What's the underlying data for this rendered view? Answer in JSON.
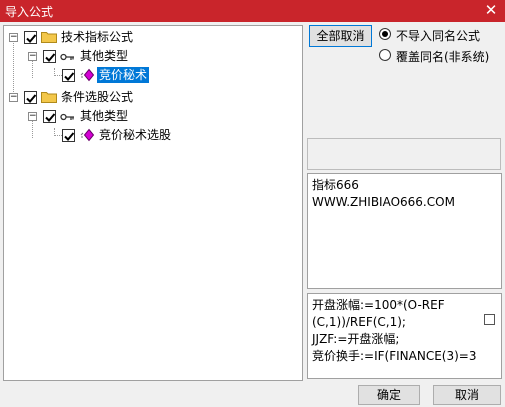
{
  "window": {
    "title": "导入公式",
    "close_glyph": "✕"
  },
  "tree": {
    "nodes": [
      {
        "label": "技术指标公式",
        "checked": true,
        "expanded": true,
        "icon": "folder-icon"
      },
      {
        "label": "其他类型",
        "checked": true,
        "expanded": true,
        "icon": "key-icon"
      },
      {
        "label": "竞价秘术",
        "checked": true,
        "selected": true,
        "icon": "formula-gem-icon"
      },
      {
        "label": "条件选股公式",
        "checked": true,
        "expanded": true,
        "icon": "folder-icon"
      },
      {
        "label": "其他类型",
        "checked": true,
        "expanded": true,
        "icon": "key-icon"
      },
      {
        "label": "竞价秘术选股",
        "checked": true,
        "icon": "formula-gem-icon"
      }
    ]
  },
  "options": {
    "deselect_all_label": "全部取消",
    "radio_no_import_label": "不导入同名公式",
    "radio_overwrite_label": "覆盖同名(非系统)",
    "selected_option": "不导入同名公式"
  },
  "info": {
    "line1": "指标666",
    "line2": "WWW.ZHIBIAO666.COM"
  },
  "formula": {
    "line1": "开盘涨幅:=100*(O-REF",
    "line2": "(C,1))/REF(C,1);",
    "line3": "JJZF:=开盘涨幅;",
    "line4": "竞价换手:=IF(FINANCE(3)=3"
  },
  "footer": {
    "ok_label": "确定",
    "cancel_label": "取消"
  },
  "colors": {
    "titlebar": "#c9252b",
    "selection": "#0078d7",
    "folder": "#f3c74a",
    "gem": "#d400d4"
  }
}
